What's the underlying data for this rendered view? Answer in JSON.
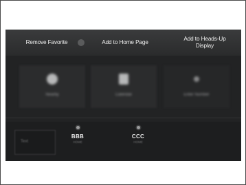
{
  "context_menu": {
    "remove_favorite": "Remove Favorite",
    "add_to_home_page": "Add to Home Page",
    "add_to_heads_up_display": "Add to Heads-Up\nDisplay"
  },
  "background_tiles": [
    {
      "icon": "circle-icon",
      "label": "Nearby"
    },
    {
      "icon": "square-icon",
      "label": "Calendar"
    },
    {
      "icon": "dot-icon",
      "label": "Enter Number"
    }
  ],
  "favorites": [
    {
      "name": "BBB",
      "sub": "HOME",
      "icon": "phone-icon"
    },
    {
      "name": "CCC",
      "sub": "HOME",
      "icon": "phone-icon"
    }
  ],
  "slot_text": "Text",
  "colors": {
    "screen_background": "#222324",
    "menu_text": "#f2f2f2",
    "frame_border": "#4a4a4a"
  }
}
